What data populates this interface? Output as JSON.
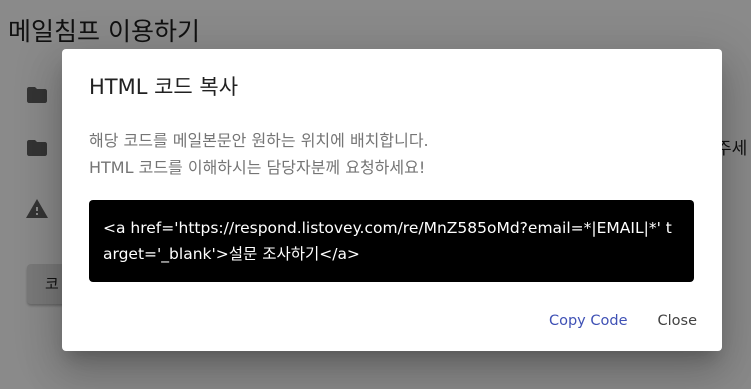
{
  "background": {
    "page_title": "메일침프 이용하기",
    "side_text": "주세",
    "button_label": "코",
    "icons": [
      "folder-icon",
      "folder-icon",
      "warning-icon"
    ]
  },
  "dialog": {
    "title": "HTML 코드 복사",
    "description_line1": "해당 코드를 메일본문안 원하는 위치에 배치합니다.",
    "description_line2": "HTML 코드를 이해하시는 담당자분께 요청하세요!",
    "code": "<a href='https://respond.listovey.com/re/MnZ585oMd?email=*|EMAIL|*' target='_blank'>설문 조사하기</a>",
    "copy_label": "Copy Code",
    "close_label": "Close"
  },
  "colors": {
    "accent": "#3f51b5",
    "code_bg": "#000000",
    "scrim": "rgba(0,0,0,0.46)"
  }
}
